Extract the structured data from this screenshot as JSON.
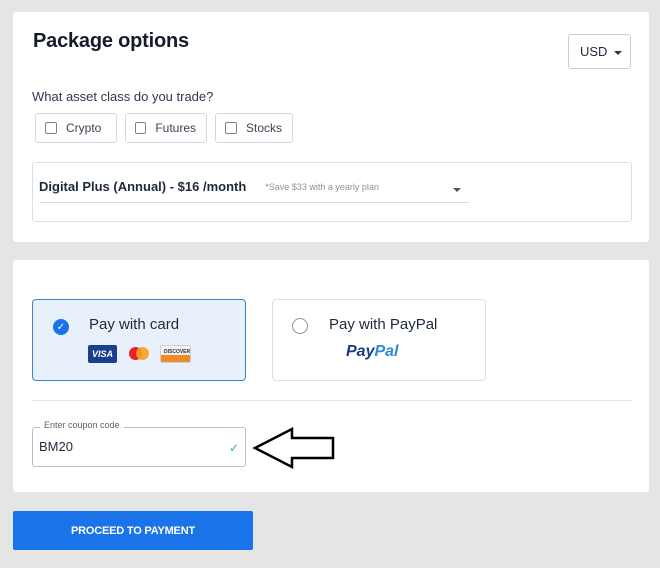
{
  "package": {
    "title": "Package options",
    "currency": "USD",
    "question": "What asset class do you trade?",
    "asset_classes": [
      {
        "label": "Crypto",
        "checked": false
      },
      {
        "label": "Futures",
        "checked": false
      },
      {
        "label": "Stocks",
        "checked": false
      }
    ],
    "plan": {
      "name": "Digital Plus (Annual) - $16 /month",
      "savings_note": "*Save $33 with a yearly plan"
    }
  },
  "payment": {
    "options": [
      {
        "label": "Pay with card",
        "selected": true,
        "logos": [
          "visa-logo",
          "mastercard-logo",
          "discover-logo"
        ]
      },
      {
        "label": "Pay with PayPal",
        "selected": false,
        "logo_text_1": "Pay",
        "logo_text_2": "Pal"
      }
    ],
    "visa_text": "VISA",
    "discover_text": "DISCOVER",
    "coupon": {
      "label": "Enter coupon code",
      "value": "BM20",
      "valid": true
    }
  },
  "proceed_label": "PROCEED TO PAYMENT",
  "colors": {
    "accent": "#1a73e8",
    "selected_bg": "#e8f1fb",
    "valid_check": "#2fae7a",
    "background": "#e5e5e5"
  }
}
